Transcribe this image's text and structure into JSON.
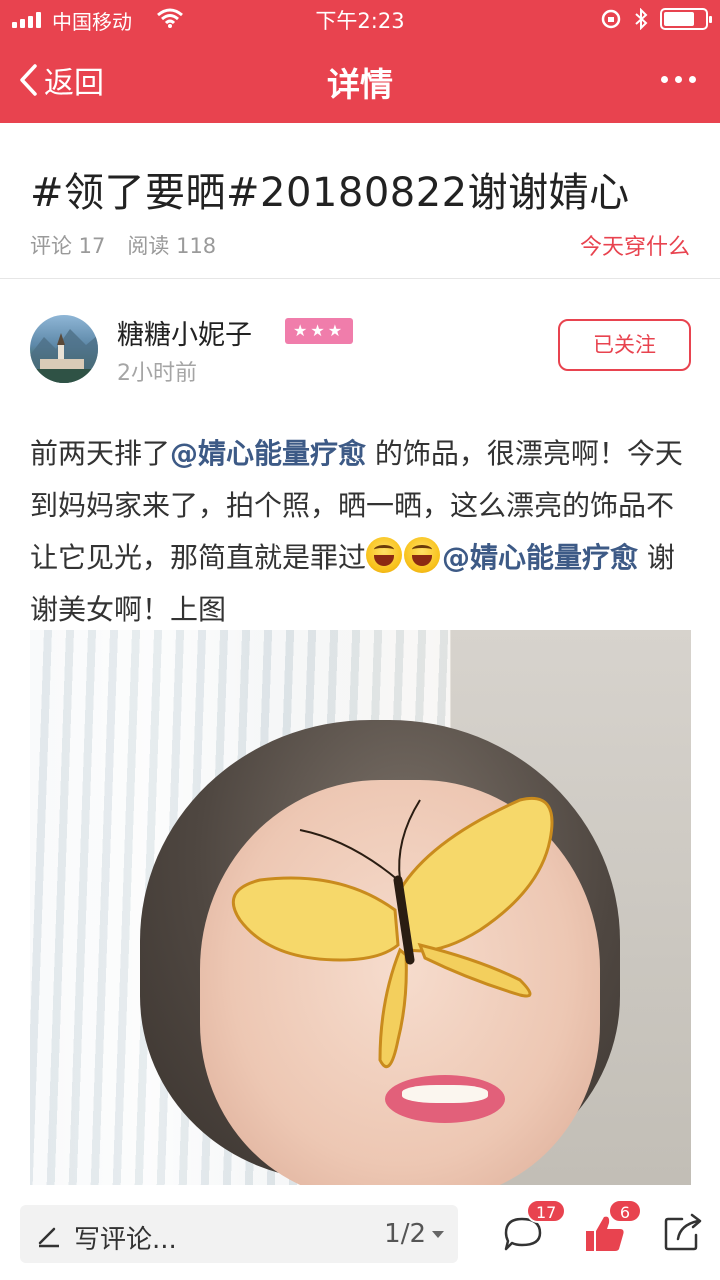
{
  "status_bar": {
    "carrier": "中国移动",
    "time": "下午2:23"
  },
  "nav": {
    "back_label": "返回",
    "title": "详情"
  },
  "post": {
    "title": "#领了要晒#20180822谢谢婧心",
    "comments_label": "评论 17",
    "reads_label": "阅读 118",
    "category_link": "今天穿什么",
    "author": {
      "name": "糖糖小妮子",
      "stars": "★★★",
      "time": "2小时前",
      "follow_label": "已关注"
    },
    "body": {
      "seg1": "前两天排了",
      "mention1": "@婧心能量疗愈",
      "seg2": " 的饰品，很漂亮啊！今天到妈妈家来了，拍个照，晒一晒，这么漂亮的饰品不让它见光，那简直就是罪过",
      "mention2": "@婧心能量疗愈",
      "seg3": " 谢谢美女啊！上图"
    }
  },
  "bottom_bar": {
    "comment_placeholder": "写评论...",
    "pager": "1/2",
    "comment_count": "17",
    "like_count": "6"
  },
  "colors": {
    "brand": "#e8434f",
    "mention": "#3d5a86",
    "star_badge": "#f07dab"
  },
  "icons": [
    "signal-icon",
    "wifi-icon",
    "lock-rotation-icon",
    "bluetooth-icon",
    "battery-icon",
    "back-chevron-icon",
    "more-icon",
    "pen-icon",
    "comment-icon",
    "thumbs-up-icon",
    "share-icon"
  ]
}
